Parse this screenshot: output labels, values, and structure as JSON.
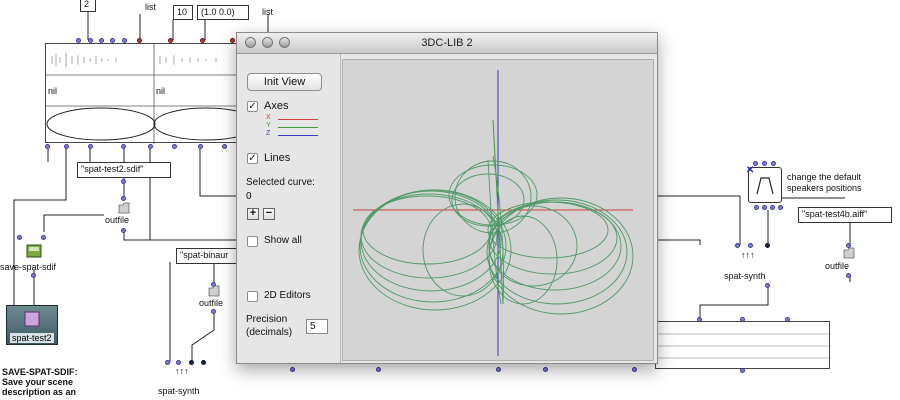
{
  "patch": {
    "top_values": [
      "2",
      "10",
      "(1.0 0.0)"
    ],
    "list_label_1": "list",
    "list_label_2": "list",
    "nil_1": "nil",
    "nil_2": "nil",
    "sdif_file": "\"spat-test2.sdif\"",
    "outfile_1": "outfile",
    "save_spat_sdif": "save-spat-sdif",
    "binaural_file": "\"spat-binaur",
    "outfile_2": "outfile",
    "spat_test2": "spat-test2",
    "spat_synth_1": "spat-synth",
    "comment_lines": [
      "SAVE-SPAT-SDIF:",
      "Save your scene",
      "description as an"
    ],
    "speakers_comment": [
      "change the default",
      "speakers positions"
    ],
    "aiff_file": "\"spat-test4b.aiff\"",
    "spat_synth_2": "spat-synth",
    "outfile_3": "outfile"
  },
  "window": {
    "title": "3DC-LIB 2",
    "init_view": "Init View",
    "axes_label": "Axes",
    "axes_checked": true,
    "axis_x": "X",
    "axis_y": "Y",
    "axis_z": "Z",
    "lines_label": "Lines",
    "lines_checked": true,
    "selected_curve_label": "Selected curve:",
    "selected_curve_value": "0",
    "plus": "+",
    "minus": "−",
    "show_all_label": "Show all",
    "show_all_checked": false,
    "editors_label": "2D Editors",
    "editors_checked": false,
    "precision_label": [
      "Precision",
      "(decimals)"
    ],
    "precision_value": "5"
  },
  "colors": {
    "axis_x": "#d23b3b",
    "axis_y": "#3f9a3f",
    "axis_z": "#3a3ac8",
    "curves": "#4f9a68",
    "inlet": "#7c7ce6",
    "inlet_red": "#c0342e"
  }
}
